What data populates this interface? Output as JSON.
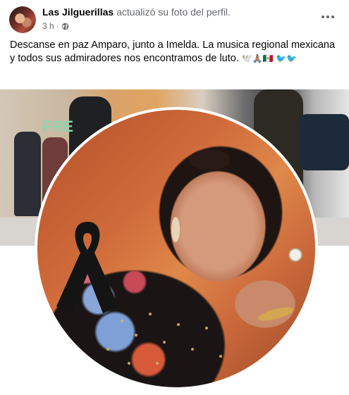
{
  "post": {
    "author": "Las Jilguerillas",
    "action": "actualizó su foto del perfil.",
    "time": "3 h",
    "separator": "·",
    "privacy_icon": "globe-icon",
    "more_icon": "more-options-icon",
    "caption": "Descanse en paz Amparo, junto a Imelda. La musica regional mexicana y todos sus admiradores nos encontramos de luto.",
    "caption_emojis": "🕊️🙏🏽🇲🇽 🐦🐦"
  },
  "media": {
    "cover_sign_text": "FRE",
    "mourning_ribbon_icon": "mourning-ribbon-icon"
  },
  "colors": {
    "text_primary": "#050505",
    "text_secondary": "#65676b",
    "background": "#ffffff"
  }
}
